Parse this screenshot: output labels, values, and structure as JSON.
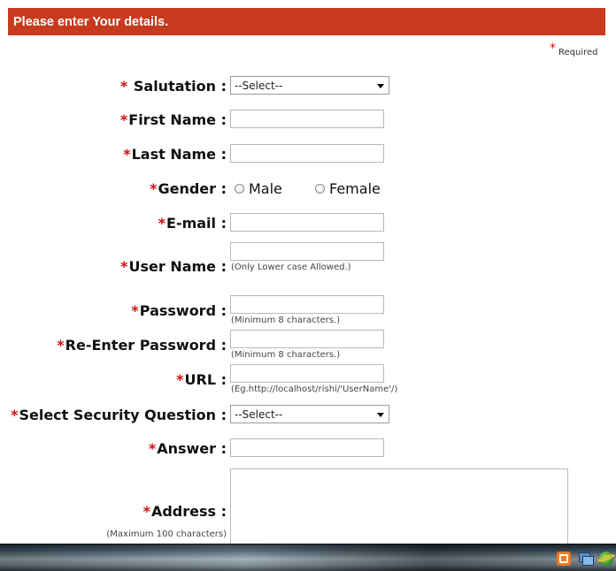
{
  "header": {
    "title": "Please enter Your details."
  },
  "required_note": {
    "star": "*",
    "text": "Required"
  },
  "form": {
    "salutation": {
      "star": "*",
      "label": "Salutation :",
      "selected": "--Select--"
    },
    "first_name": {
      "star": "*",
      "label": "First Name :"
    },
    "last_name": {
      "star": "*",
      "label": "Last Name :"
    },
    "gender": {
      "star": "*",
      "label": "Gender :",
      "options": [
        "Male",
        "Female"
      ]
    },
    "email": {
      "star": "*",
      "label": "E-mail :"
    },
    "user_name": {
      "star": "*",
      "label": "User Name :",
      "hint": "(Only Lower case Allowed.)"
    },
    "password": {
      "star": "*",
      "label": "Password :",
      "hint": "(Minimum 8 characters.)"
    },
    "re_password": {
      "star": "*",
      "label": "Re-Enter Password :",
      "hint": "(Minimum 8 characters.)"
    },
    "url": {
      "star": "*",
      "label": "URL :",
      "hint": "(Eg.http://localhost/rishi/'UserName'/)"
    },
    "security_question": {
      "star": "*",
      "label": "Select Security Question :",
      "selected": "--Select--"
    },
    "answer": {
      "star": "*",
      "label": "Answer :"
    },
    "address": {
      "star": "*",
      "label": "Address :",
      "hint": "(Maximum 100 characters)"
    }
  },
  "taskbar": {
    "tray_icons": [
      "xampp-icon",
      "network-icon",
      "browser-icon"
    ]
  }
}
